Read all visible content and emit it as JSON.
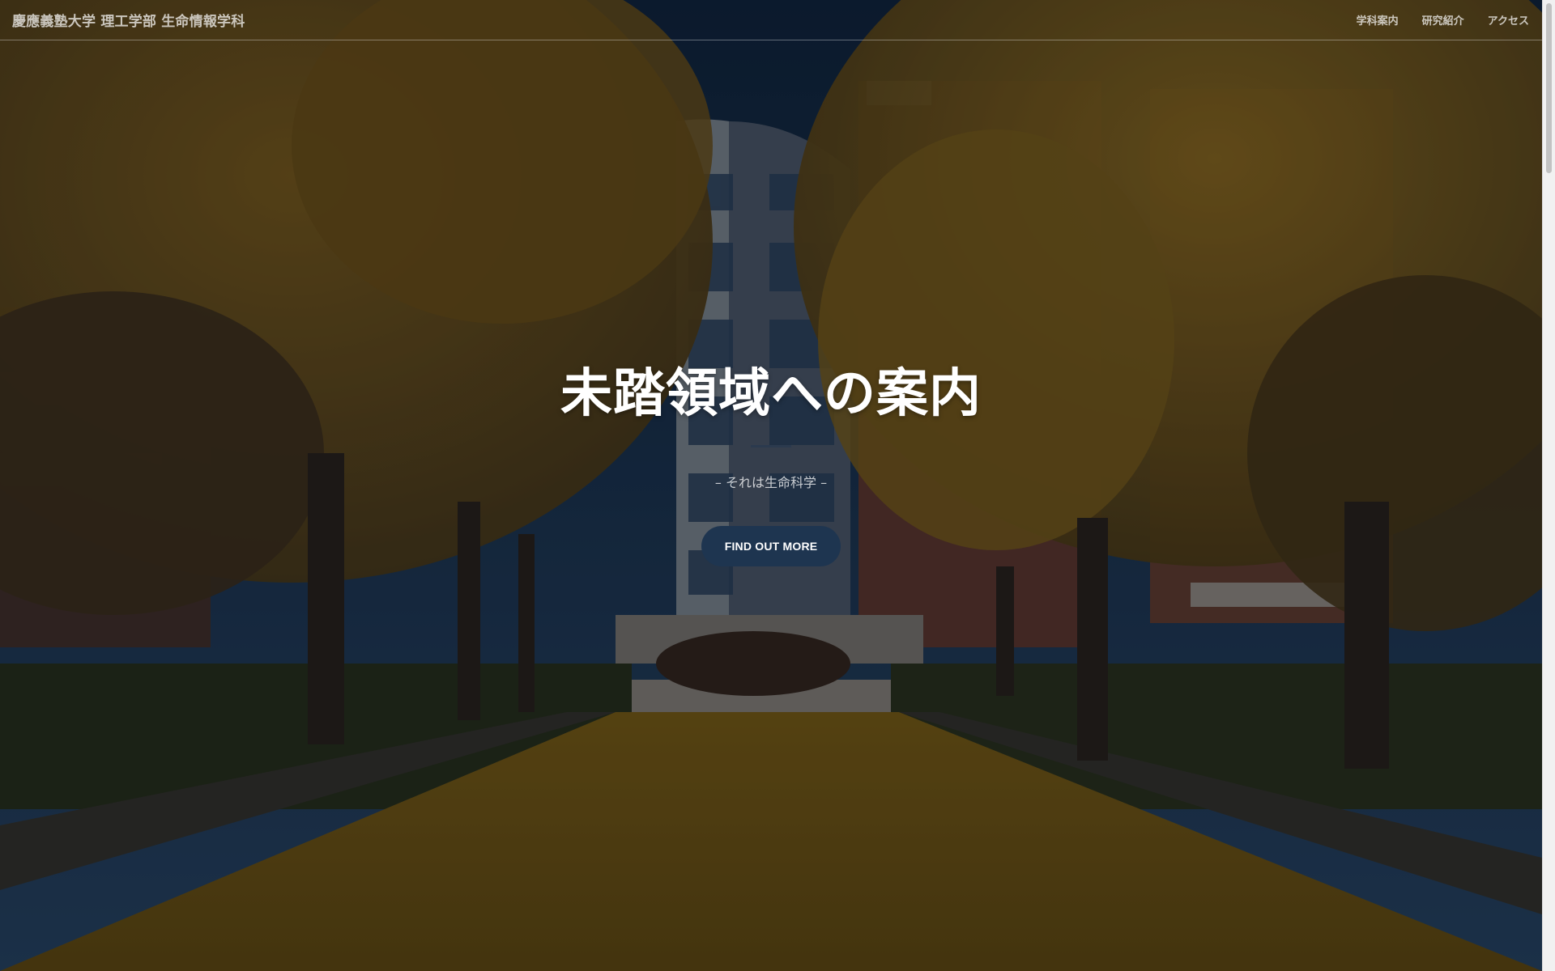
{
  "navbar": {
    "brand": "慶應義塾大学 理工学部 生命情報学科",
    "links": [
      {
        "label": "学科案内"
      },
      {
        "label": "研究紹介"
      },
      {
        "label": "アクセス"
      }
    ]
  },
  "hero": {
    "title": "未踏領域への案内",
    "subtitle": "– それは生命科学 –",
    "cta_label": "FIND OUT MORE",
    "background_image": "campus-ginkgo-avenue"
  },
  "colors": {
    "cta_background": "#1e3550",
    "divider": "#2b3a4e",
    "foliage": "#b88a1e",
    "sky": "#1f3c5e"
  }
}
